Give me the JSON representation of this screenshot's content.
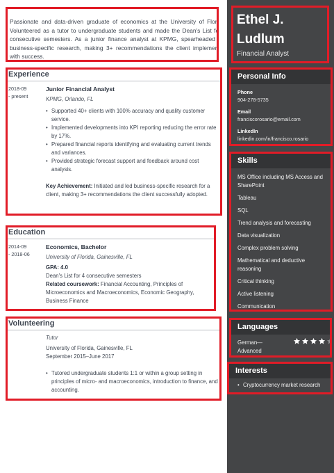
{
  "summary": "Passionate and data-driven graduate of economics at the University of Florida. Volunteered as a tutor to undergraduate students and made the Dean's List for 4 consecutive semesters. As a junior finance analyst at KPMG, spearheaded the business-specific research, making 3+ recommendations the client implemented with success.",
  "experience": {
    "title": "Experience",
    "date_start": "2018-09",
    "date_end": "- present",
    "role": "Junior Financial Analyst",
    "place": "KPMG, Orlando, FL",
    "bullets": [
      "Supported 40+ clients with 100% accuracy and quality customer service.",
      "Implemented developments into KPI reporting reducing the error rate by 17%.",
      "Prepared financial reports identifying and evaluating current trends and variances.",
      "Provided strategic forecast support and feedback around cost analysis."
    ],
    "achievement_label": "Key Achievement:",
    "achievement_text": "Initiated and led business-specific research for a client, making 3+ recommendations the client successfully adopted."
  },
  "education": {
    "title": "Education",
    "date_start": "2014-09",
    "date_end": "- 2018-06",
    "degree": "Economics, Bachelor",
    "school": "University of Florida, Gainesville, FL",
    "gpa": "GPA: 4.0",
    "deans": "Dean's List for 4 consecutive semesters",
    "coursework_label": "Related coursework:",
    "coursework_text": "Financial Accounting, Principles of Microeconomics and Macroeconomics, Economic Geography, Business Finance"
  },
  "volunteering": {
    "title": "Volunteering",
    "role": "Tutor",
    "place": "University of Florida, Gainesville, FL",
    "dates": "September 2015–June 2017",
    "bullet": "Tutored undergraduate students 1:1 or within a group setting in principles of micro- and macroeconomics, introduction to finance, and accounting."
  },
  "profile": {
    "name_line1": "Ethel J.",
    "name_line2": "Ludlum",
    "job_title": "Financial Analyst"
  },
  "personal_info": {
    "title": "Personal Info",
    "phone_label": "Phone",
    "phone": "904-278-5735",
    "email_label": "Email",
    "email": "franciscorosario@email.com",
    "linkedin_label": "LinkedIn",
    "linkedin": "linkedin.com/in/francisco.rosario"
  },
  "skills": {
    "title": "Skills",
    "items": [
      "MS Office including MS Access and SharePoint",
      "Tableau",
      "SQL",
      "Trend analysis and forecasting",
      "Data visualization",
      "Complex problem solving",
      "Mathematical and deductive reasoning",
      "Critical thinking",
      "Active listening",
      "Communication"
    ]
  },
  "languages": {
    "title": "Languages",
    "name": "German—Advanced",
    "rating": 4,
    "rating_max": 5,
    "star_on_color": "#ffffff",
    "star_off_color": "#8e8f92"
  },
  "interests": {
    "title": "Interests",
    "items": [
      "Cryptocurrency market research"
    ]
  },
  "colors": {
    "highlight": "#e11c27",
    "sidebar": "#444547",
    "band": "#333436"
  }
}
